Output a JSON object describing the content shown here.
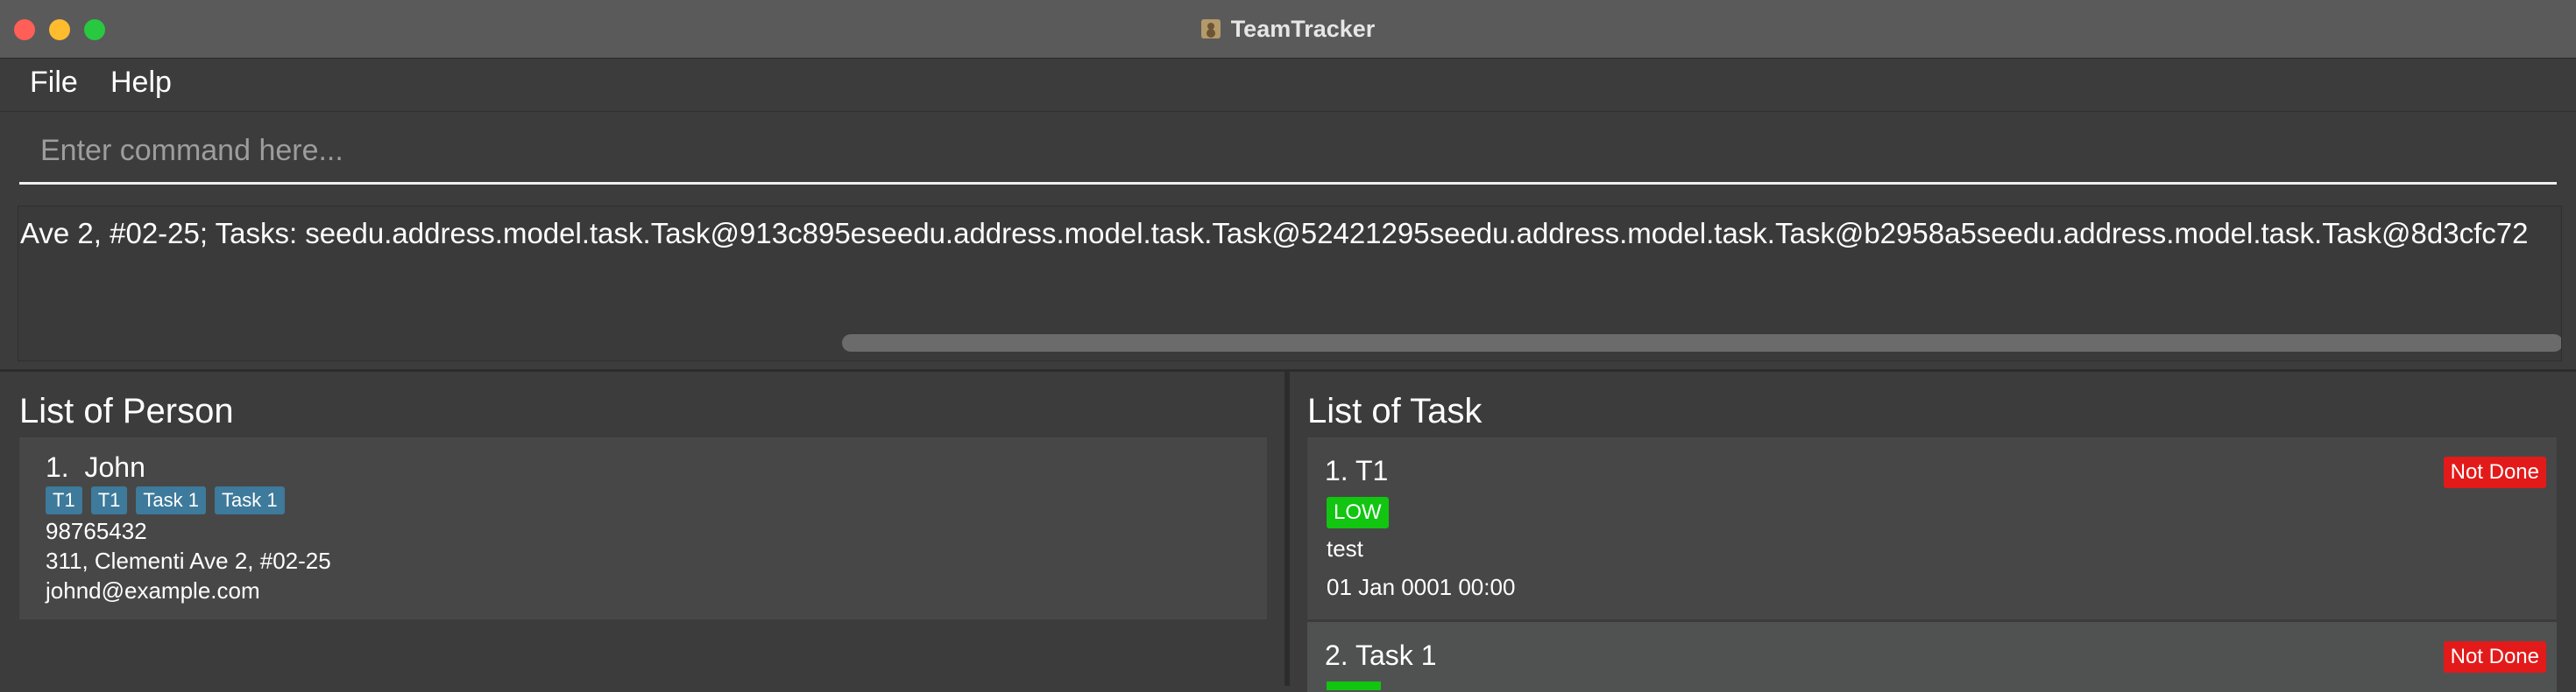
{
  "window": {
    "title": "TeamTracker",
    "icon": "contact-book-icon"
  },
  "menu": {
    "items": [
      "File",
      "Help"
    ]
  },
  "command": {
    "placeholder": "Enter command here...",
    "value": ""
  },
  "result": {
    "text": "Ave 2, #02-25; Tasks: seedu.address.model.task.Task@913c895eseedu.address.model.task.Task@52421295seedu.address.model.task.Task@b2958a5seedu.address.model.task.Task@8d3cfc72"
  },
  "people": {
    "title": "List of Person",
    "items": [
      {
        "index": "1.",
        "name": "John",
        "tags": [
          "T1",
          "T1",
          "Task 1",
          "Task 1"
        ],
        "phone": "98765432",
        "address": "311, Clementi Ave 2, #02-25",
        "email": "johnd@example.com"
      }
    ]
  },
  "tasks": {
    "title": "List of Task",
    "items": [
      {
        "name": "1. T1",
        "status": "Not Done",
        "priority": "LOW",
        "description": "test",
        "date": "01 Jan 0001 00:00"
      },
      {
        "name": "2. Task 1",
        "status": "Not Done"
      }
    ]
  },
  "colors": {
    "background": "#3c3c3c",
    "tag": "#3d7a9b",
    "status_not_done": "#e31a1a",
    "priority_low": "#11c511"
  }
}
